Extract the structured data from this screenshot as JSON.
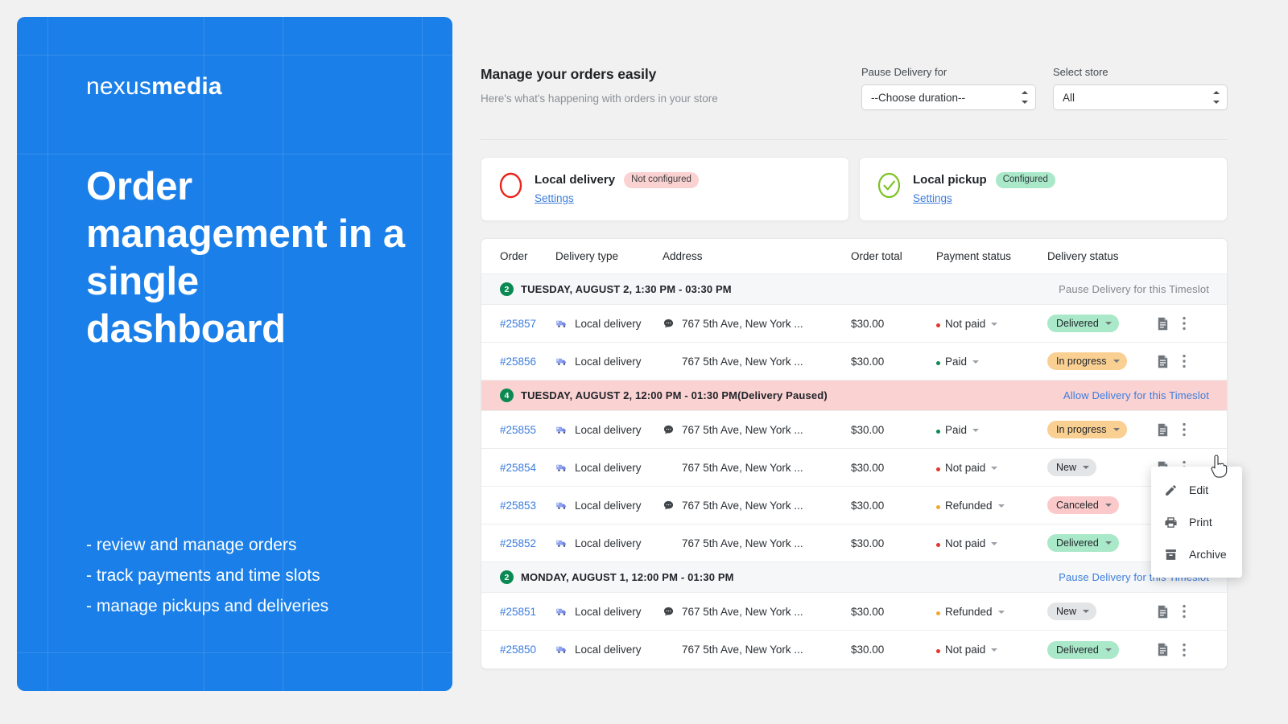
{
  "hero": {
    "logo_light": "nexus",
    "logo_bold": "media",
    "headline": "Order management in a single dashboard",
    "bullets": [
      "- review and manage orders",
      "- track payments and time slots",
      "- manage pickups and deliveries"
    ],
    "brand_color": "#1a7fe8"
  },
  "header": {
    "title": "Manage your orders easily",
    "subtitle": "Here's what's happening with orders in your store",
    "pause_delivery_label": "Pause Delivery for",
    "pause_delivery_value": "--Choose duration--",
    "select_store_label": "Select store",
    "select_store_value": "All"
  },
  "cards": [
    {
      "title": "Local delivery",
      "status": "Not configured",
      "status_type": "red",
      "link": "Settings",
      "icon": "circle-outline-red-icon",
      "icon_color": "#e8241a"
    },
    {
      "title": "Local pickup",
      "status": "Configured",
      "status_type": "green",
      "link": "Settings",
      "icon": "check-circle-green-icon",
      "icon_color": "#7ec423"
    }
  ],
  "table": {
    "columns": [
      "Order",
      "Delivery type",
      "Address",
      "Order total",
      "Payment status",
      "Delivery status"
    ],
    "groups": [
      {
        "count": "2",
        "label": "TUESDAY, AUGUST 2, 1:30 PM - 03:30 PM",
        "action": "Pause Delivery for this Timeslot",
        "paused": false,
        "rows": [
          {
            "order": "#25857",
            "delivery_type": "Local delivery",
            "has_note": true,
            "address": "767 5th Ave, New York ...",
            "total": "$30.00",
            "payment": "Not paid",
            "payment_dot": "red",
            "delivery": "Delivered",
            "delivery_style": "green"
          },
          {
            "order": "#25856",
            "delivery_type": "Local delivery",
            "has_note": false,
            "address": "767 5th Ave, New York ...",
            "total": "$30.00",
            "payment": "Paid",
            "payment_dot": "green",
            "delivery": "In progress",
            "delivery_style": "orange"
          }
        ]
      },
      {
        "count": "4",
        "label": "TUESDAY, AUGUST 2, 12:00 PM - 01:30 PM(Delivery Paused)",
        "action": "Allow Delivery for this Timeslot",
        "paused": true,
        "rows": [
          {
            "order": "#25855",
            "delivery_type": "Local delivery",
            "has_note": true,
            "address": "767 5th Ave, New York ...",
            "total": "$30.00",
            "payment": "Paid",
            "payment_dot": "green",
            "delivery": "In progress",
            "delivery_style": "orange"
          },
          {
            "order": "#25854",
            "delivery_type": "Local delivery",
            "has_note": false,
            "address": "767 5th Ave, New York ...",
            "total": "$30.00",
            "payment": "Not paid",
            "payment_dot": "red",
            "delivery": "New",
            "delivery_style": "grey"
          },
          {
            "order": "#25853",
            "delivery_type": "Local delivery",
            "has_note": true,
            "address": "767 5th Ave, New York ...",
            "total": "$30.00",
            "payment": "Refunded",
            "payment_dot": "amber",
            "delivery": "Canceled",
            "delivery_style": "red"
          },
          {
            "order": "#25852",
            "delivery_type": "Local delivery",
            "has_note": false,
            "address": "767 5th Ave, New York ...",
            "total": "$30.00",
            "payment": "Not paid",
            "payment_dot": "red",
            "delivery": "Delivered",
            "delivery_style": "green"
          }
        ]
      },
      {
        "count": "2",
        "label": "MONDAY, AUGUST 1, 12:00 PM - 01:30 PM",
        "action": "Pause Delivery for this Timeslot",
        "paused": false,
        "monday": true,
        "rows": [
          {
            "order": "#25851",
            "delivery_type": "Local delivery",
            "has_note": true,
            "address": "767 5th Ave, New York ...",
            "total": "$30.00",
            "payment": "Refunded",
            "payment_dot": "amber",
            "delivery": "New",
            "delivery_style": "grey"
          },
          {
            "order": "#25850",
            "delivery_type": "Local delivery",
            "has_note": false,
            "address": "767 5th Ave, New York ...",
            "total": "$30.00",
            "payment": "Not paid",
            "payment_dot": "red",
            "delivery": "Delivered",
            "delivery_style": "green"
          }
        ]
      }
    ]
  },
  "context_menu": {
    "items": [
      {
        "label": "Edit",
        "icon": "pencil-icon"
      },
      {
        "label": "Print",
        "icon": "printer-icon"
      },
      {
        "label": "Archive",
        "icon": "archive-icon"
      }
    ]
  }
}
